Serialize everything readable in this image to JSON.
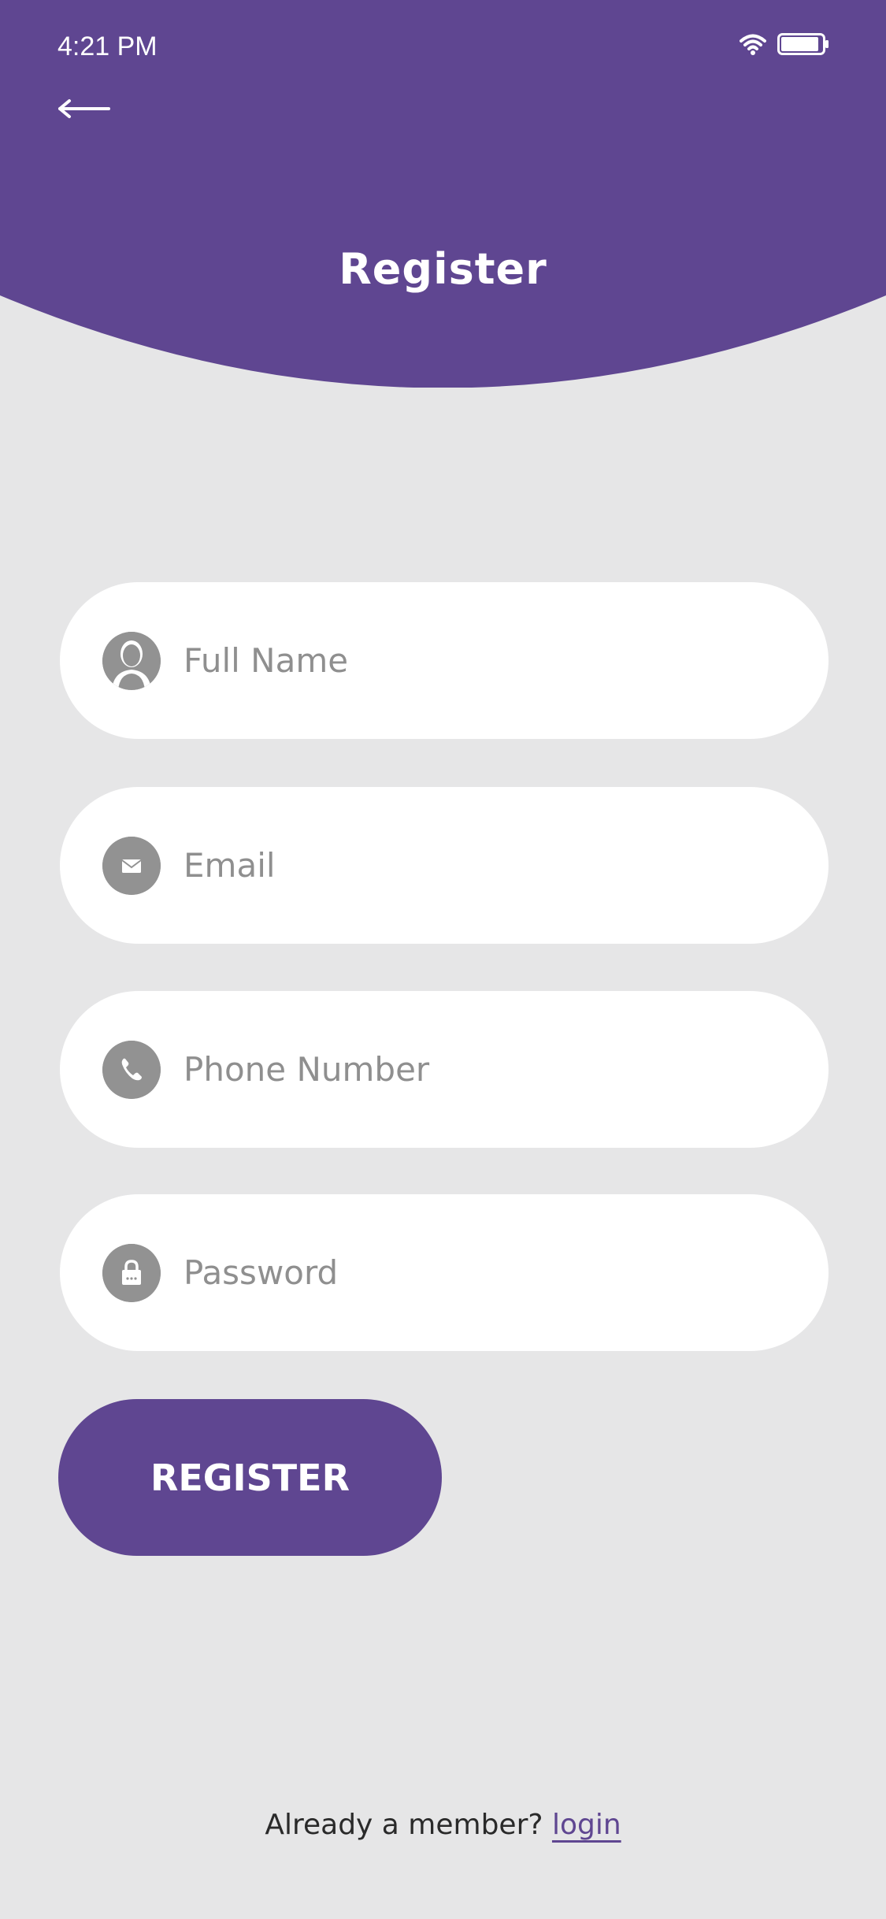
{
  "status_bar": {
    "time": "4:21 PM"
  },
  "header": {
    "title": "Register",
    "background_color": "#5f4691"
  },
  "form": {
    "fields": [
      {
        "placeholder": "Full Name",
        "value": "",
        "icon": "user-icon"
      },
      {
        "placeholder": "Email",
        "value": "",
        "icon": "envelope-icon"
      },
      {
        "placeholder": "Phone Number",
        "value": "",
        "icon": "phone-icon"
      },
      {
        "placeholder": "Password",
        "value": "",
        "icon": "lock-icon"
      }
    ],
    "submit_label": "REGISTER"
  },
  "footer": {
    "prompt": "Already a member?",
    "login_label": "login"
  },
  "colors": {
    "accent": "#5f4691",
    "page_background": "#e6e6e7",
    "field_background": "#ffffff",
    "icon_gray": "#929292"
  }
}
